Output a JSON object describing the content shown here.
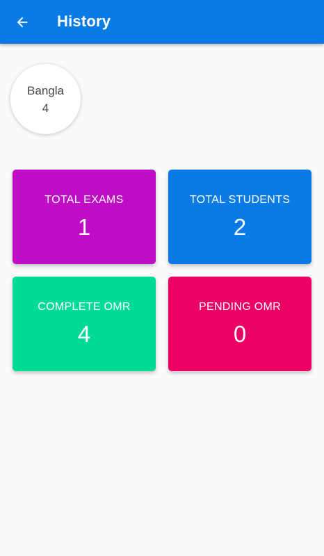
{
  "app_bar": {
    "title": "History",
    "back_icon": "arrow-left-icon",
    "color": "#0a7be4"
  },
  "subject": {
    "name": "Bangla",
    "count": "4"
  },
  "stats": {
    "total_exams": {
      "label": "TOTAL EXAMS",
      "value": "1",
      "color": "#bf0cc5"
    },
    "total_students": {
      "label": "TOTAL STUDENTS",
      "value": "2",
      "color": "#0a7be4"
    },
    "complete_omr": {
      "label": "COMPLETE OMR",
      "value": "4",
      "color": "#00dc95"
    },
    "pending_omr": {
      "label": "PENDING OMR",
      "value": "0",
      "color": "#ec0065"
    }
  }
}
